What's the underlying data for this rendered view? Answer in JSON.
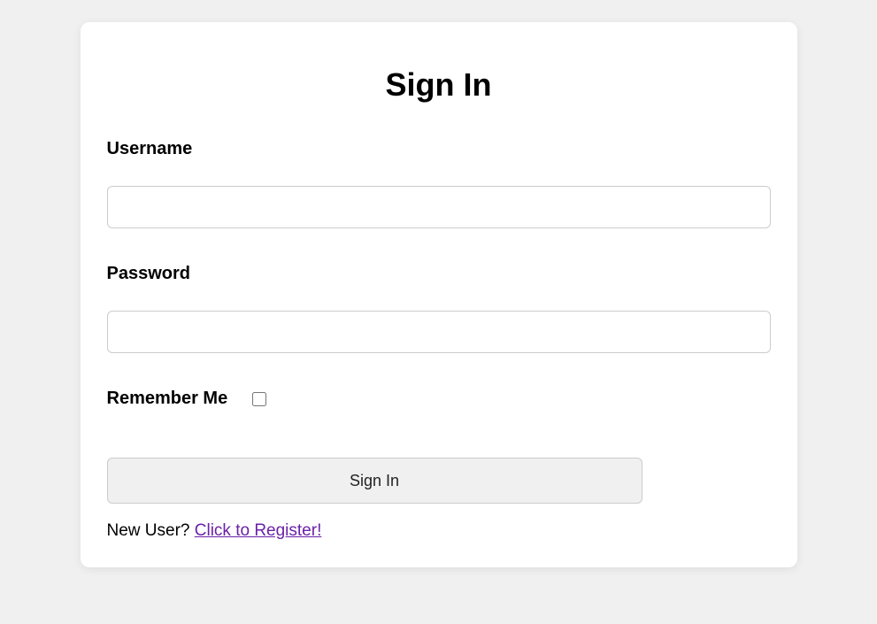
{
  "form": {
    "title": "Sign In",
    "usernameLabel": "Username",
    "usernameValue": "",
    "passwordLabel": "Password",
    "passwordValue": "",
    "rememberLabel": "Remember Me",
    "rememberChecked": false,
    "submitLabel": "Sign In",
    "newUserText": "New User? ",
    "registerLinkText": "Click to Register!"
  }
}
